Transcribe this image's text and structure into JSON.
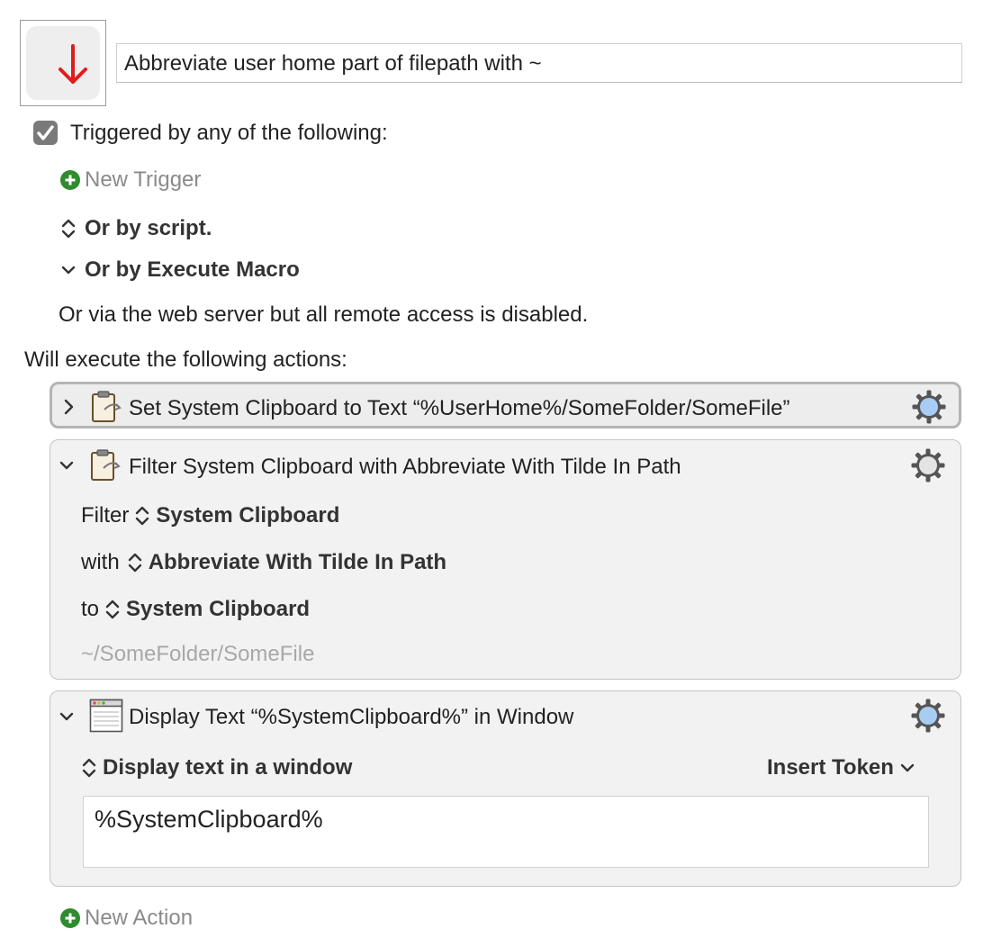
{
  "macro": {
    "name": "Abbreviate user home part of filepath with ~",
    "icon": "down-arrow-icon",
    "icon_color": "#e41b1b"
  },
  "triggers": {
    "label": "Triggered by any of the following:",
    "enabled": true,
    "new_trigger_label": "New Trigger",
    "by_script_label": "Or by script.",
    "by_execute_macro_label": "Or by Execute Macro",
    "web_server_text": "Or via the web server but all remote access is disabled."
  },
  "actions": {
    "header": "Will execute the following actions:",
    "items": [
      {
        "title": "Set System Clipboard to Text “%UserHome%/SomeFolder/SomeFile”",
        "expanded": false,
        "selected": true,
        "icon": "clipboard-icon"
      },
      {
        "title": "Filter System Clipboard with Abbreviate With Tilde In Path",
        "expanded": true,
        "icon": "clipboard-icon",
        "filter_label": "Filter",
        "filter_value": "System Clipboard",
        "with_label": "with",
        "with_value": "Abbreviate With Tilde In Path",
        "to_label": "to",
        "to_value": "System Clipboard",
        "preview": "~/SomeFolder/SomeFile"
      },
      {
        "title": "Display Text “%SystemClipboard%” in Window",
        "expanded": true,
        "icon": "window-icon",
        "mode_label": "Display text in a window",
        "insert_token_label": "Insert Token",
        "text": "%SystemClipboard%"
      }
    ],
    "new_action_label": "New Action"
  },
  "colors": {
    "add_green": "#2e8b2e",
    "gear_blue": "#a8cdf4",
    "panel_bg": "#f2f2f2"
  }
}
